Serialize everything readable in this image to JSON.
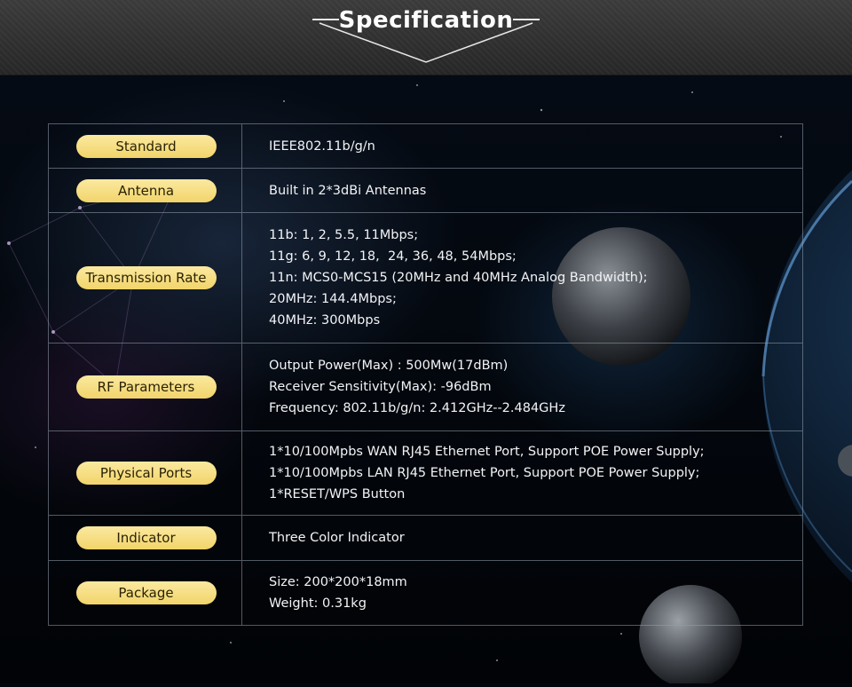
{
  "header": {
    "title": "Specification"
  },
  "colors": {
    "pill": "#f4d873",
    "border": "#96a0af",
    "header_bg": "#303030"
  },
  "rows": [
    {
      "label": "Standard",
      "lines": [
        "IEEE802.11b/g/n"
      ]
    },
    {
      "label": "Antenna",
      "lines": [
        "Built in 2*3dBi Antennas"
      ]
    },
    {
      "label": "Transmission Rate",
      "lines": [
        "11b: 1, 2, 5.5, 11Mbps;",
        "11g: 6, 9, 12, 18,  24, 36, 48, 54Mbps;",
        "11n: MCS0-MCS15 (20MHz and 40MHz Analog Bandwidth);",
        "20MHz: 144.4Mbps;",
        "40MHz: 300Mbps"
      ]
    },
    {
      "label": "RF Parameters",
      "lines": [
        "Output Power(Max) : 500Mw(17dBm)",
        "Receiver Sensitivity(Max): -96dBm",
        "Frequency: 802.11b/g/n: 2.412GHz--2.484GHz"
      ]
    },
    {
      "label": "Physical Ports",
      "lines": [
        "1*10/100Mpbs WAN RJ45 Ethernet Port, Support POE Power Supply;",
        "1*10/100Mpbs LAN RJ45 Ethernet Port, Support POE Power Supply;",
        "1*RESET/WPS Button"
      ]
    },
    {
      "label": "Indicator",
      "lines": [
        "Three Color Indicator"
      ]
    },
    {
      "label": "Package",
      "lines": [
        "Size: 200*200*18mm",
        "Weight: 0.31kg"
      ]
    }
  ]
}
